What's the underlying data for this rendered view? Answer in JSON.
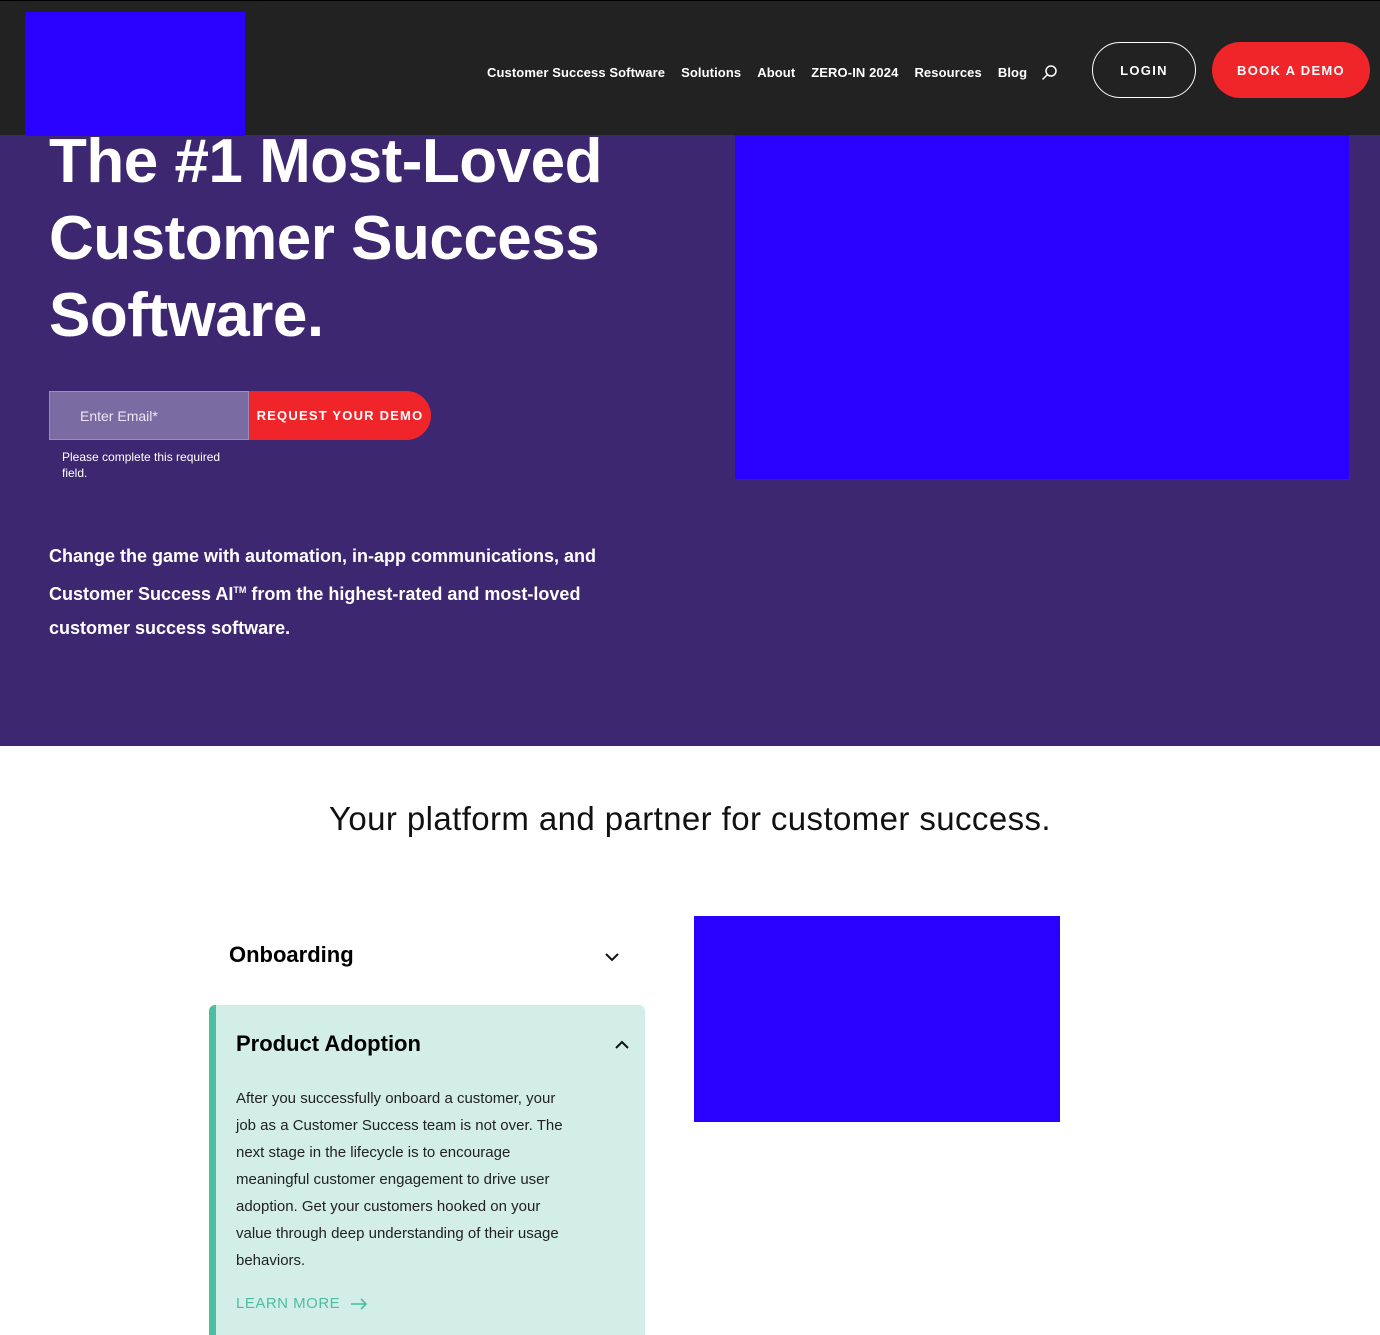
{
  "nav": {
    "items": [
      {
        "label": "Customer Success Software"
      },
      {
        "label": "Solutions"
      },
      {
        "label": "About"
      },
      {
        "label": "ZERO-IN 2024"
      },
      {
        "label": "Resources"
      },
      {
        "label": "Blog"
      }
    ],
    "search_icon": "search-icon",
    "login_label": "LOGIN",
    "book_demo_label": "BOOK A DEMO"
  },
  "hero": {
    "title": "The #1 Most-Loved Customer Success Software.",
    "email_placeholder": "Enter Email*",
    "request_button": "REQUEST YOUR DEMO",
    "required_message": "Please complete this required field.",
    "subtitle_part1": "Change the game with automation, in-app communications, and Customer Success AI",
    "subtitle_tm": "TM",
    "subtitle_part2": " from the highest-rated and most-loved customer success software."
  },
  "section": {
    "title": "Your platform and partner for customer success."
  },
  "accordion": {
    "collapsed_title": "Onboarding",
    "expanded_title": "Product Adoption",
    "expanded_body": "After you successfully onboard a customer, your job as a Customer Success team is not over. The next stage in the lifecycle is to encourage meaningful customer engagement to drive user adoption. Get your customers hooked on your value through deep understanding of their usage behaviors.",
    "learn_more": "LEARN MORE"
  },
  "colors": {
    "header_bg": "#222222",
    "hero_bg": "#3c2770",
    "accent_red": "#f0252a",
    "accent_teal": "#4dbfa0",
    "panel_bg": "#d3ede7",
    "placeholder_blue": "#2a00ff"
  }
}
